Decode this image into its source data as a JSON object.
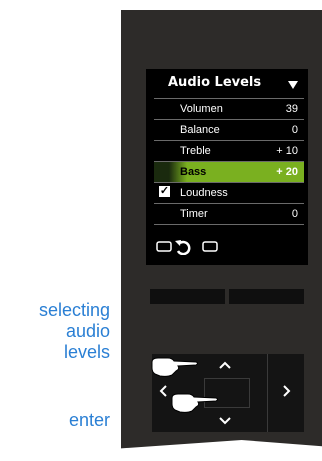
{
  "screen": {
    "title": "Audio Levels",
    "rows": [
      {
        "label": "Volumen",
        "value": "39"
      },
      {
        "label": "Balance",
        "value": "0"
      },
      {
        "label": "Treble",
        "value": "+ 10"
      },
      {
        "label": "Bass",
        "value": "+ 20"
      },
      {
        "label": "Loudness",
        "value": ""
      },
      {
        "label": "Timer",
        "value": "0"
      }
    ],
    "selected_row": "Bass",
    "loudness_checked": true,
    "checkmark": "☑"
  },
  "annotations": {
    "selecting_line1": "selecting",
    "selecting_line2": "audio",
    "selecting_line3": "levels",
    "enter": "enter"
  },
  "colors": {
    "device": "#2d2b29",
    "highlight": "#7ab020",
    "annotation": "#2a7fd4"
  },
  "icons": {
    "menu": "triangle-down",
    "back": "back-arrow",
    "nav_up": "chevron-up",
    "nav_down": "chevron-down",
    "nav_left": "chevron-left",
    "nav_right": "chevron-right",
    "hand": "pointing-hand"
  }
}
